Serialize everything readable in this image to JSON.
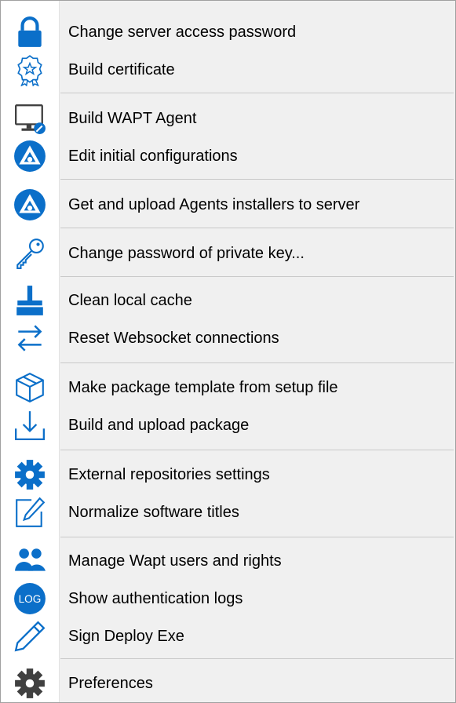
{
  "menu": {
    "items": [
      {
        "label": "Change server access password",
        "icon": "lock-icon"
      },
      {
        "label": "Build certificate",
        "icon": "certificate-icon"
      },
      {
        "label": "Build WAPT Agent",
        "icon": "monitor-icon"
      },
      {
        "label": "Edit initial configurations",
        "icon": "wapt-logo-icon"
      },
      {
        "label": "Get and upload Agents installers to server",
        "icon": "wapt-logo-icon"
      },
      {
        "label": "Change password of private key...",
        "icon": "key-icon"
      },
      {
        "label": "Clean local cache",
        "icon": "broom-icon"
      },
      {
        "label": "Reset Websocket connections",
        "icon": "arrows-exchange-icon"
      },
      {
        "label": "Make package template from setup file",
        "icon": "box-icon"
      },
      {
        "label": "Build and upload package",
        "icon": "download-tray-icon"
      },
      {
        "label": "External repositories settings",
        "icon": "gear-icon"
      },
      {
        "label": "Normalize software titles",
        "icon": "edit-icon"
      },
      {
        "label": "Manage Wapt users and rights",
        "icon": "users-icon"
      },
      {
        "label": "Show authentication logs",
        "icon": "log-icon",
        "icon_text": "LOG"
      },
      {
        "label": "Sign Deploy Exe",
        "icon": "pencil-icon"
      },
      {
        "label": "Preferences",
        "icon": "gear-icon"
      }
    ]
  },
  "colors": {
    "icon_blue": "#0b6fc9",
    "icon_dark": "#404040",
    "separator": "#c9c9c9"
  }
}
